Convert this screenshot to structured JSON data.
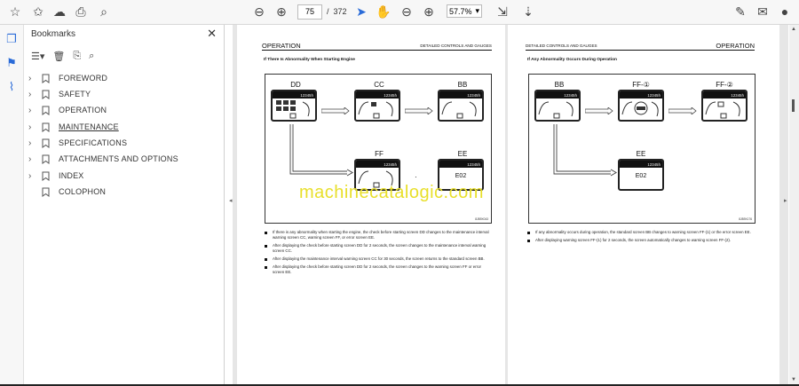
{
  "toolbar": {
    "page_current": "75",
    "page_separator": "/",
    "page_total": "372",
    "zoom": "57.7%"
  },
  "bookmarks_panel": {
    "title": "Bookmarks",
    "items": [
      {
        "label": "FOREWORD"
      },
      {
        "label": "SAFETY"
      },
      {
        "label": "OPERATION"
      },
      {
        "label": "MAINTENANCE"
      },
      {
        "label": "SPECIFICATIONS"
      },
      {
        "label": "ATTACHMENTS AND OPTIONS"
      },
      {
        "label": "INDEX"
      },
      {
        "label": "COLOPHON"
      }
    ]
  },
  "page_left": {
    "header_left": "OPERATION",
    "header_right": "DETAILED CONTROLS AND GAUGES",
    "section_title": "If There Is Abnormality When Starting Engine",
    "screens": {
      "dd": "DD",
      "cc": "CC",
      "bb": "BB",
      "ff": "FF",
      "ee": "EE",
      "status_bar": "12345h",
      "ee_code": "E02"
    },
    "fig_ref": "8JB9X043",
    "bullets": [
      "If there is any abnormality when starting the engine, the check before starting screen DD changes to the maintenance interval warning screen CC, warning screen FF, or error screen EE.",
      "After displaying the check before starting screen DD for 2 seconds, the screen changes to the maintenance interval warning screen CC.",
      "After displaying the maintenance interval warning screen CC for 30 seconds, the screen returns to the standard screen BB.",
      "After displaying the check before starting screen DD for 2 seconds, the screen changes to the warning screen FF or error screen EE."
    ]
  },
  "page_right": {
    "header_left": "DETAILED CONTROLS AND GAUGES",
    "header_right": "OPERATION",
    "section_title": "If Any Abnormality Occurs During Operation",
    "screens": {
      "bb": "BB",
      "ff1": "FF-①",
      "ff2": "FF-②",
      "ee": "EE",
      "status_bar": "12345h",
      "ee_code": "E02"
    },
    "fig_ref": "8JB9X176",
    "bullets": [
      "If any abnormality occurs during operation, the standard screen BB changes to warning screen FF-(1) or the error screen EE.",
      "After displaying warning screen FF-(1) for 2 seconds, the screen automatically changes to warning screen FF-(2)."
    ]
  },
  "watermark": "machinecatalogic.com",
  "colors": {
    "accent": "#2a6bd8",
    "watermark": "#e8df2a"
  }
}
